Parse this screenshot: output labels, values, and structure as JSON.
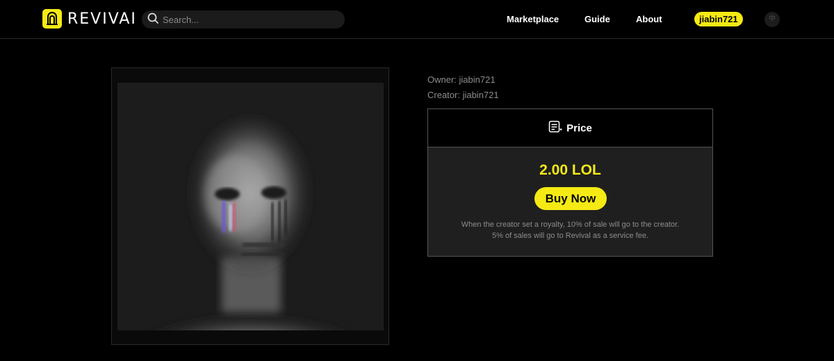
{
  "brand": {
    "name": "REVIVAI",
    "accent": "#F5EA14"
  },
  "search": {
    "placeholder": "Search..."
  },
  "nav": {
    "items": [
      {
        "label": "Marketplace"
      },
      {
        "label": "Guide"
      },
      {
        "label": "About"
      }
    ],
    "user": "jiabin721",
    "lang": "中"
  },
  "artwork": {
    "icon": "portrait-image"
  },
  "details": {
    "owner": "Owner: jiabin721",
    "creator": "Creator: jiabin721"
  },
  "price": {
    "header_label": "Price",
    "header_icon": "price-tag-icon",
    "value": "2.00 LOL",
    "buy_label": "Buy Now",
    "note_line1": "When the creator set a royalty, 10% of sale will go to the creator.",
    "note_line2": "5% of sales will go to Revival as a service fee."
  }
}
